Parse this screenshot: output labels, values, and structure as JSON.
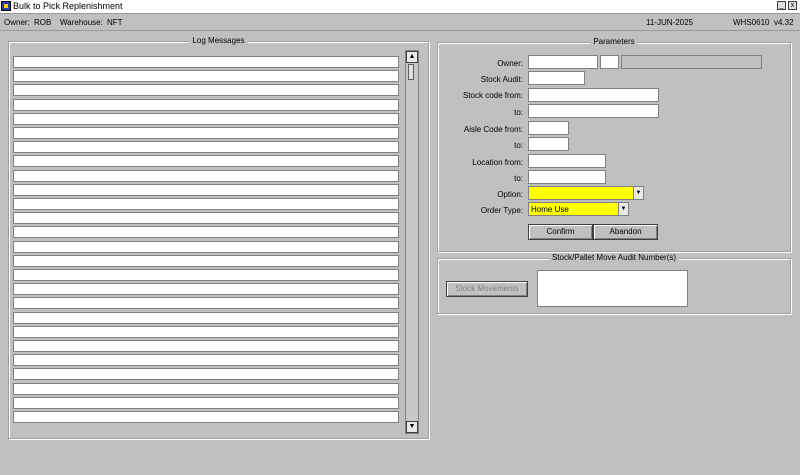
{
  "window": {
    "title": "Bulk to Pick Replenishment",
    "minimize": "_",
    "close": "x"
  },
  "status": {
    "owner_label": "Owner:",
    "owner_value": "ROB",
    "warehouse_label": "Warehouse:",
    "warehouse_value": "NFT",
    "date": "11-JUN-2025",
    "program": "WHS0610",
    "version": "v4.32"
  },
  "log": {
    "title": "Log Messages",
    "rows": 26,
    "scroll_up": "▲",
    "scroll_down": "▼"
  },
  "params": {
    "title": "Parameters",
    "owner_label": "Owner:",
    "stock_audit_label": "Stock Audit:",
    "stock_code_from_label": "Stock code from:",
    "stock_code_to_label": "to:",
    "aisle_from_label": "Aisle Code from:",
    "aisle_to_label": "to:",
    "location_from_label": "Location from:",
    "location_to_label": "to:",
    "option_label": "Option:",
    "option_value": "",
    "order_type_label": "Order Type:",
    "order_type_value": "Home Use",
    "dropdown_arrow": "▼",
    "confirm": "Confirm",
    "abandon": "Abandon"
  },
  "audit": {
    "title": "Stock/Pallet Move Audit Number(s)",
    "stock_movements": "Stock Movements"
  },
  "colors": {
    "background": "#c0c0c0",
    "highlight_field": "#ffff00"
  }
}
